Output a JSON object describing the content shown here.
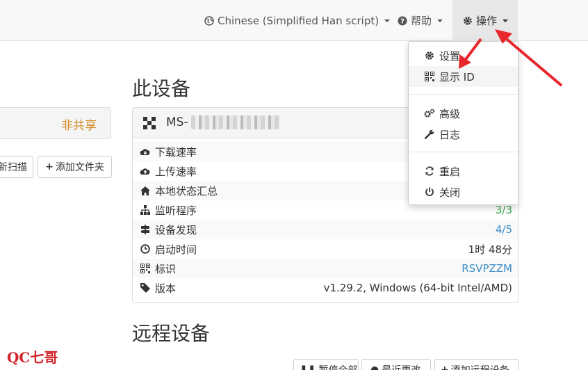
{
  "navbar": {
    "language": "Chinese (Simplified Han script)",
    "help": "帮助",
    "actions": "操作"
  },
  "actions_menu": {
    "items": [
      {
        "label": "设置",
        "icon": "gear-icon"
      },
      {
        "label": "显示 ID",
        "icon": "qrcode-icon"
      },
      {
        "label": "高级",
        "icon": "gears-icon"
      },
      {
        "label": "日志",
        "icon": "wrench-icon"
      },
      {
        "label": "重启",
        "icon": "refresh-icon"
      },
      {
        "label": "关闭",
        "icon": "power-icon"
      }
    ]
  },
  "left": {
    "share_status": "非共享",
    "rescan_button": "新扫描",
    "add_folder_button": "添加文件夹"
  },
  "this_device": {
    "title": "此设备",
    "name_prefix": "MS-",
    "rows": [
      {
        "label": "下载速率",
        "value": "",
        "icon": "cloud-download-icon"
      },
      {
        "label": "上传速率",
        "value": "",
        "icon": "cloud-upload-icon"
      },
      {
        "label": "本地状态汇总",
        "value": "",
        "icon": "home-icon"
      },
      {
        "label": "监听程序",
        "value": "3/3",
        "icon": "sitemap-icon"
      },
      {
        "label": "设备发现",
        "value": "4/5",
        "icon": "signpost-icon"
      },
      {
        "label": "启动时间",
        "value": "1时 48分",
        "icon": "clock-icon"
      },
      {
        "label": "标识",
        "value": "RSVPZZM",
        "icon": "qrcode-icon"
      },
      {
        "label": "版本",
        "value": "v1.29.2, Windows (64-bit Intel/AMD)",
        "icon": "tag-icon"
      }
    ]
  },
  "remote_devices": {
    "title": "远程设备",
    "buttons": [
      "暂停全部",
      "最近更改",
      "添加远程设备"
    ]
  },
  "watermark": "QC七哥",
  "colors": {
    "green": "#3aa84c",
    "blue": "#3a8bc7",
    "orange": "#d28a23",
    "arrow": "#e8272d"
  }
}
